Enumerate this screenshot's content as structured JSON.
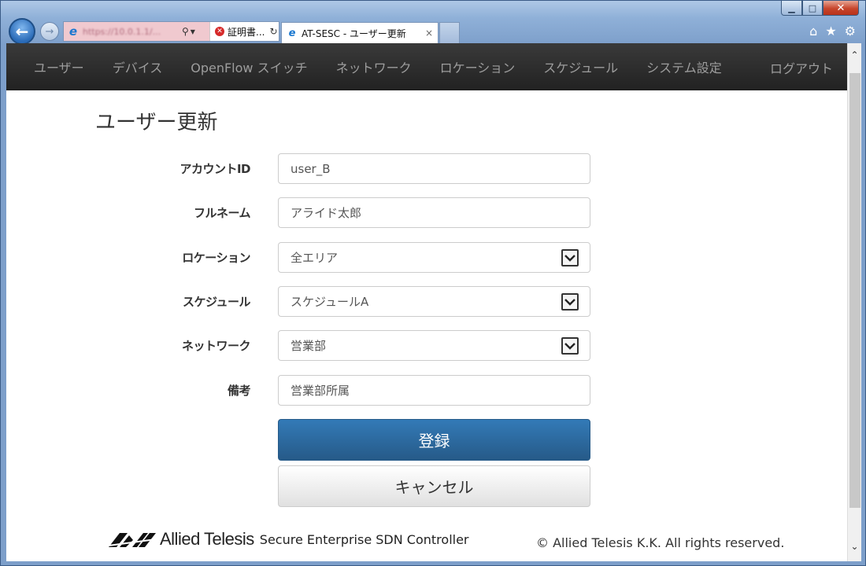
{
  "browser": {
    "url_blurred": "https://10.0.1.1/...",
    "cert_label": "証明書...",
    "tab_title": "AT-SESC - ユーザー更新",
    "tab_close": "×",
    "window_controls": {
      "minimize": "▁",
      "maximize": "□",
      "close": "✕"
    },
    "tool_icons": {
      "home": "⌂",
      "favorites": "★",
      "settings": "⚙"
    }
  },
  "navbar": {
    "items": [
      {
        "label": "ユーザー"
      },
      {
        "label": "デバイス"
      },
      {
        "label": "OpenFlow スイッチ"
      },
      {
        "label": "ネットワーク"
      },
      {
        "label": "ロケーション"
      },
      {
        "label": "スケジュール"
      },
      {
        "label": "システム設定"
      }
    ],
    "logout": "ログアウト"
  },
  "page": {
    "title": "ユーザー更新"
  },
  "form": {
    "account_id": {
      "label": "アカウントID",
      "value": "user_B"
    },
    "full_name": {
      "label": "フルネーム",
      "value": "アライド太郎"
    },
    "location": {
      "label": "ロケーション",
      "value": "全エリア"
    },
    "schedule": {
      "label": "スケジュール",
      "value": "スケジュールA"
    },
    "network": {
      "label": "ネットワーク",
      "value": "営業部"
    },
    "notes": {
      "label": "備考",
      "value": "営業部所属"
    },
    "submit_label": "登録",
    "cancel_label": "キャンセル"
  },
  "footer": {
    "brand": "Allied Telesis",
    "product": "Secure Enterprise SDN Controller",
    "copyright": "© Allied Telesis K.K. All rights reserved."
  },
  "colors": {
    "navbar_bg": "#222222",
    "primary": "#337ab7",
    "brand": "#222222"
  }
}
